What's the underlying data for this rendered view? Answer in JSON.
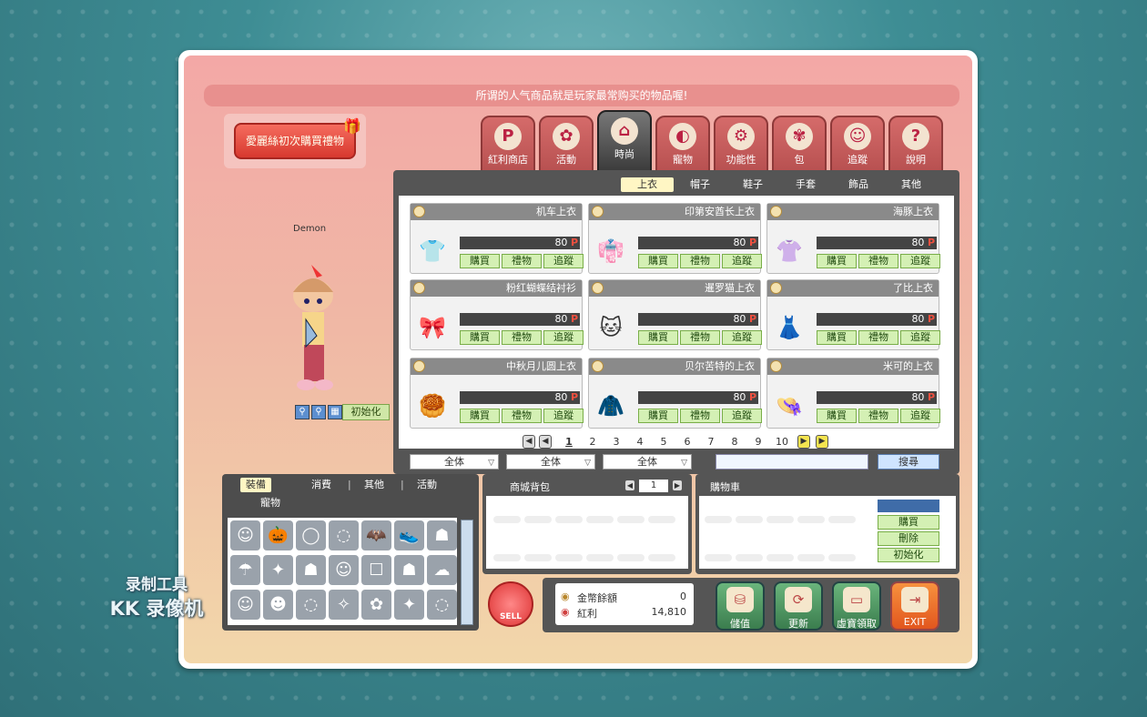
{
  "banner": "所谓的人气商品就是玩家最常购买的物品喔!",
  "gift_button": "愛麗絲初次購買禮物",
  "character_name": "Demon",
  "character_reset": "初始化",
  "tabs": [
    {
      "label": "紅利商店",
      "icon": "P"
    },
    {
      "label": "活動",
      "icon": "✿"
    },
    {
      "label": "時尚",
      "icon": "⌂"
    },
    {
      "label": "寵物",
      "icon": "◐"
    },
    {
      "label": "功能性",
      "icon": "⚙"
    },
    {
      "label": "包",
      "icon": "✾"
    },
    {
      "label": "追蹤",
      "icon": "☺"
    },
    {
      "label": "說明",
      "icon": "?"
    }
  ],
  "subtabs": [
    "上衣",
    "帽子",
    "鞋子",
    "手套",
    "飾品",
    "其他"
  ],
  "items": [
    {
      "name": "机车上衣",
      "price": "80",
      "icon": "👕"
    },
    {
      "name": "印第安酋长上衣",
      "price": "80",
      "icon": "👘"
    },
    {
      "name": "海豚上衣",
      "price": "80",
      "icon": "👚"
    },
    {
      "name": "粉红蝴蝶结衬衫",
      "price": "80",
      "icon": "🎀"
    },
    {
      "name": "暹罗猫上衣",
      "price": "80",
      "icon": "🐱"
    },
    {
      "name": "了比上衣",
      "price": "80",
      "icon": "👗"
    },
    {
      "name": "中秋月儿圆上衣",
      "price": "80",
      "icon": "🥮"
    },
    {
      "name": "贝尔苦特的上衣",
      "price": "80",
      "icon": "🧥"
    },
    {
      "name": "米可的上衣",
      "price": "80",
      "icon": "👒"
    }
  ],
  "price_unit": "P",
  "buttons": {
    "buy": "購買",
    "gift": "禮物",
    "track": "追蹤"
  },
  "pages": [
    "1",
    "2",
    "3",
    "4",
    "5",
    "6",
    "7",
    "8",
    "9",
    "10"
  ],
  "filters": [
    "全体",
    "全体",
    "全体"
  ],
  "search_label": "搜尋",
  "inventory_tabs": [
    "裝備",
    "消費",
    "其他",
    "活動",
    "寵物"
  ],
  "inventory_icons": [
    "☺",
    "🎃",
    "◯",
    "◌",
    "🦇",
    "👟",
    "☗",
    "☂",
    "✦",
    "☗",
    "☺",
    "☐",
    "☗",
    "☁",
    "☺",
    "☻",
    "◌",
    "✧",
    "✿",
    "✦",
    "◌"
  ],
  "bag_title": "商城背包",
  "bag_page": "1",
  "cart_title": "購物車",
  "cart_buttons": [
    "購買",
    "刪除",
    "初始化"
  ],
  "sell_label": "SELL",
  "balance": {
    "gold_label": "金幣餘額",
    "gold_value": "0",
    "bonus_label": "紅利",
    "bonus_value": "14,810"
  },
  "actions": [
    {
      "label": "儲值",
      "icon": "⛁"
    },
    {
      "label": "更新",
      "icon": "⟳"
    },
    {
      "label": "虛寶領取",
      "icon": "▭"
    },
    {
      "label": "EXIT",
      "icon": "⇥"
    }
  ],
  "watermark": [
    "录制工具",
    "KK 录像机"
  ],
  "colors": {
    "accent": "#e8908e",
    "active_tab": "#3c3c3c",
    "green_btn": "#d4f0b4"
  }
}
